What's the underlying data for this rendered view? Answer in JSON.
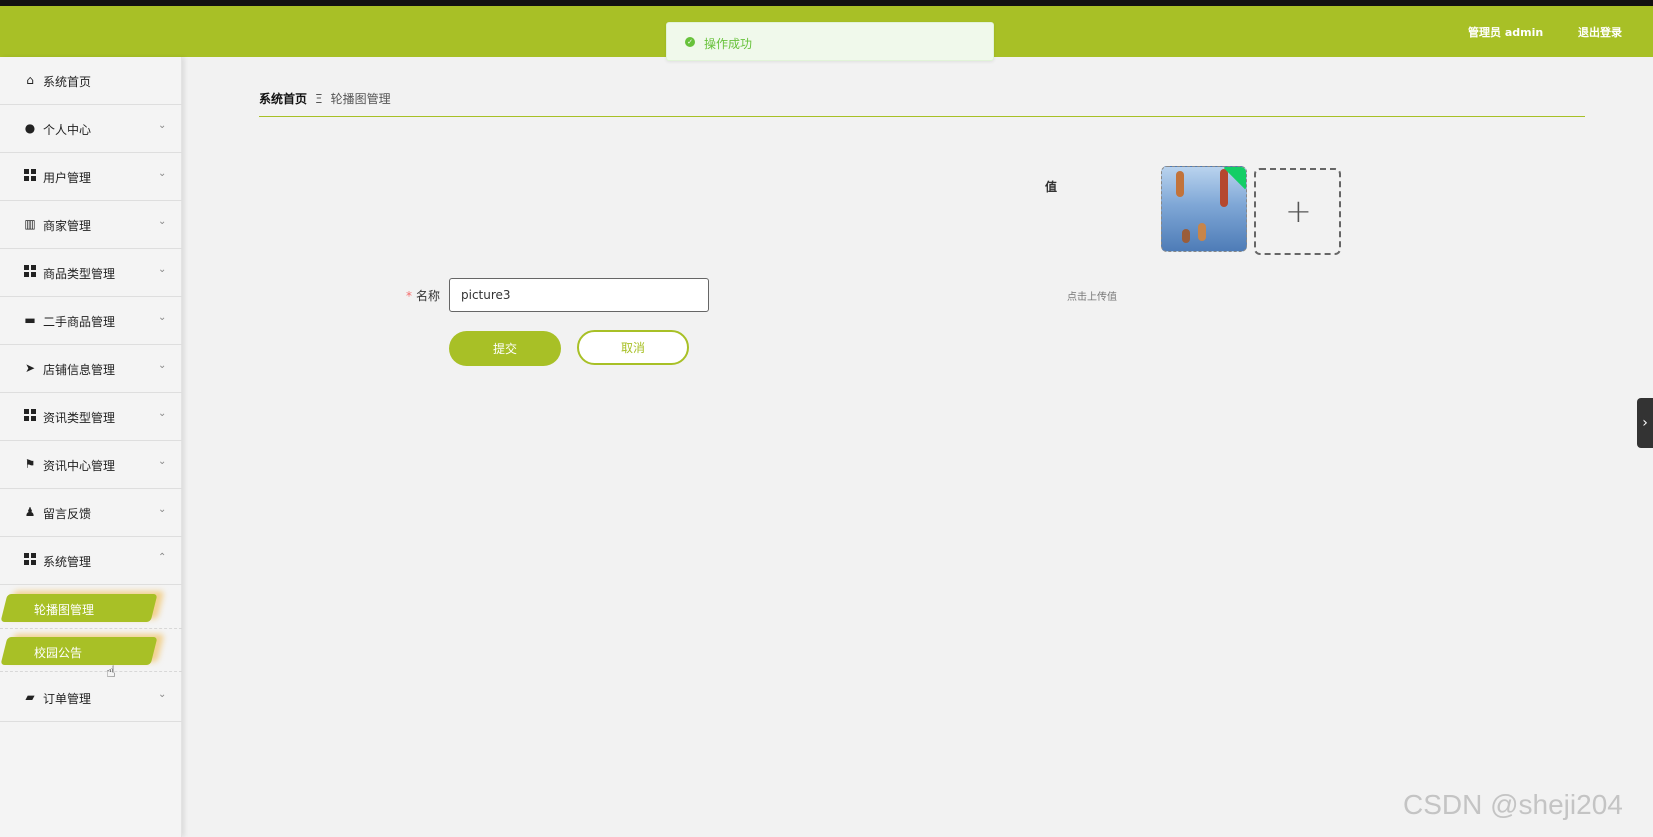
{
  "header": {
    "user_label": "管理员 admin",
    "logout_label": "退出登录",
    "accent_color": "#a8c026"
  },
  "toast": {
    "message": "操作成功",
    "icon": "check-circle-icon",
    "color": "#67c23a"
  },
  "sidebar": {
    "items": [
      {
        "label": "系统首页",
        "icon": "home-icon"
      },
      {
        "label": "个人中心",
        "icon": "user-icon"
      },
      {
        "label": "用户管理",
        "icon": "grid-icon"
      },
      {
        "label": "商家管理",
        "icon": "library-icon"
      },
      {
        "label": "商品类型管理",
        "icon": "grid-icon"
      },
      {
        "label": "二手商品管理",
        "icon": "chat-icon"
      },
      {
        "label": "店铺信息管理",
        "icon": "send-icon"
      },
      {
        "label": "资讯类型管理",
        "icon": "grid-icon"
      },
      {
        "label": "资讯中心管理",
        "icon": "flag-icon"
      },
      {
        "label": "留言反馈",
        "icon": "person-icon"
      },
      {
        "label": "系统管理",
        "icon": "grid-icon"
      },
      {
        "label": "订单管理",
        "icon": "wallet-icon"
      }
    ],
    "sub_items": [
      {
        "label": "轮播图管理"
      },
      {
        "label": "校园公告"
      }
    ]
  },
  "breadcrumb": {
    "home": "系统首页",
    "separator": "Ξ",
    "current": "轮播图管理"
  },
  "form": {
    "value_label": "值",
    "upload_tip": "点击上传值",
    "name_label": "名称",
    "required_mark": "*",
    "name_value": "picture3",
    "submit_label": "提交",
    "cancel_label": "取消"
  },
  "side_tab_glyph": "›",
  "watermark": "CSDN @sheji204"
}
